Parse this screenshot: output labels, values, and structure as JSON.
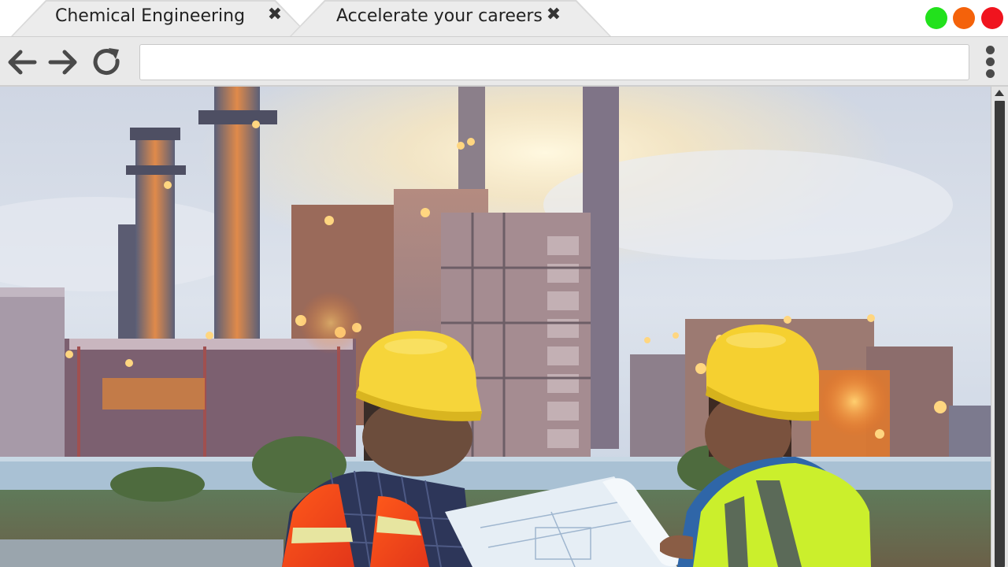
{
  "tabs": [
    {
      "label": "Chemical Engineering",
      "close_glyph": "✖"
    },
    {
      "label": "Accelerate your careers",
      "close_glyph": "✖"
    }
  ],
  "window_controls": [
    {
      "name": "maximize",
      "color": "#22e11c"
    },
    {
      "name": "minimize",
      "color": "#f4620a"
    },
    {
      "name": "close",
      "color": "#f0141e"
    }
  ],
  "toolbar": {
    "back_icon": "arrow-left-icon",
    "forward_icon": "arrow-right-icon",
    "reload_icon": "reload-icon",
    "address_value": "",
    "menu_icon": "kebab-menu-icon"
  },
  "content": {
    "image_subject": "hero-photo"
  }
}
